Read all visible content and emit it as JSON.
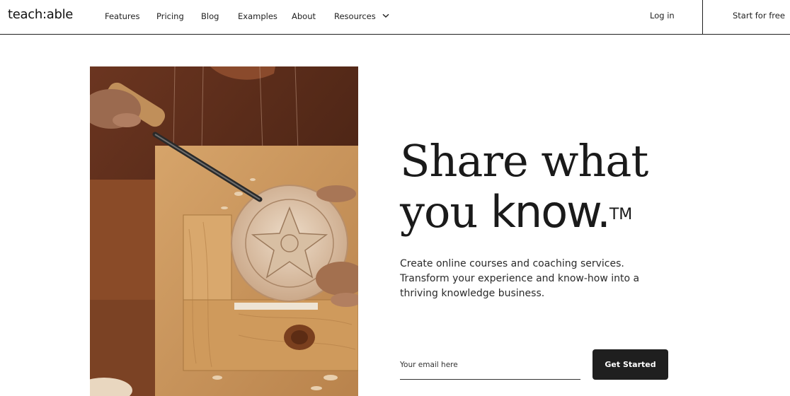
{
  "brand": {
    "logo_text": "teach:able"
  },
  "nav": {
    "links": [
      {
        "label": "Features"
      },
      {
        "label": "Pricing"
      },
      {
        "label": "Blog"
      },
      {
        "label": "Examples"
      },
      {
        "label": "About"
      },
      {
        "label": "Resources"
      }
    ],
    "login_label": "Log in",
    "start_label": "Start for free"
  },
  "hero": {
    "headline_line1": "Share what",
    "headline_line2_serif": "you ",
    "headline_line2_sans": "know.",
    "trademark": "TM",
    "subtext": "Create online courses and coaching services. Transform your experience and know-how into a thriving knowledge business.",
    "email_placeholder": "Your email here",
    "cta_label": "Get Started",
    "image_alt": "hands carving a wooden bowl with a chisel"
  },
  "colors": {
    "text": "#1a1a1a",
    "cta_bg": "#1f1f1f",
    "cta_text": "#ffffff",
    "border": "#1f1f1f"
  }
}
